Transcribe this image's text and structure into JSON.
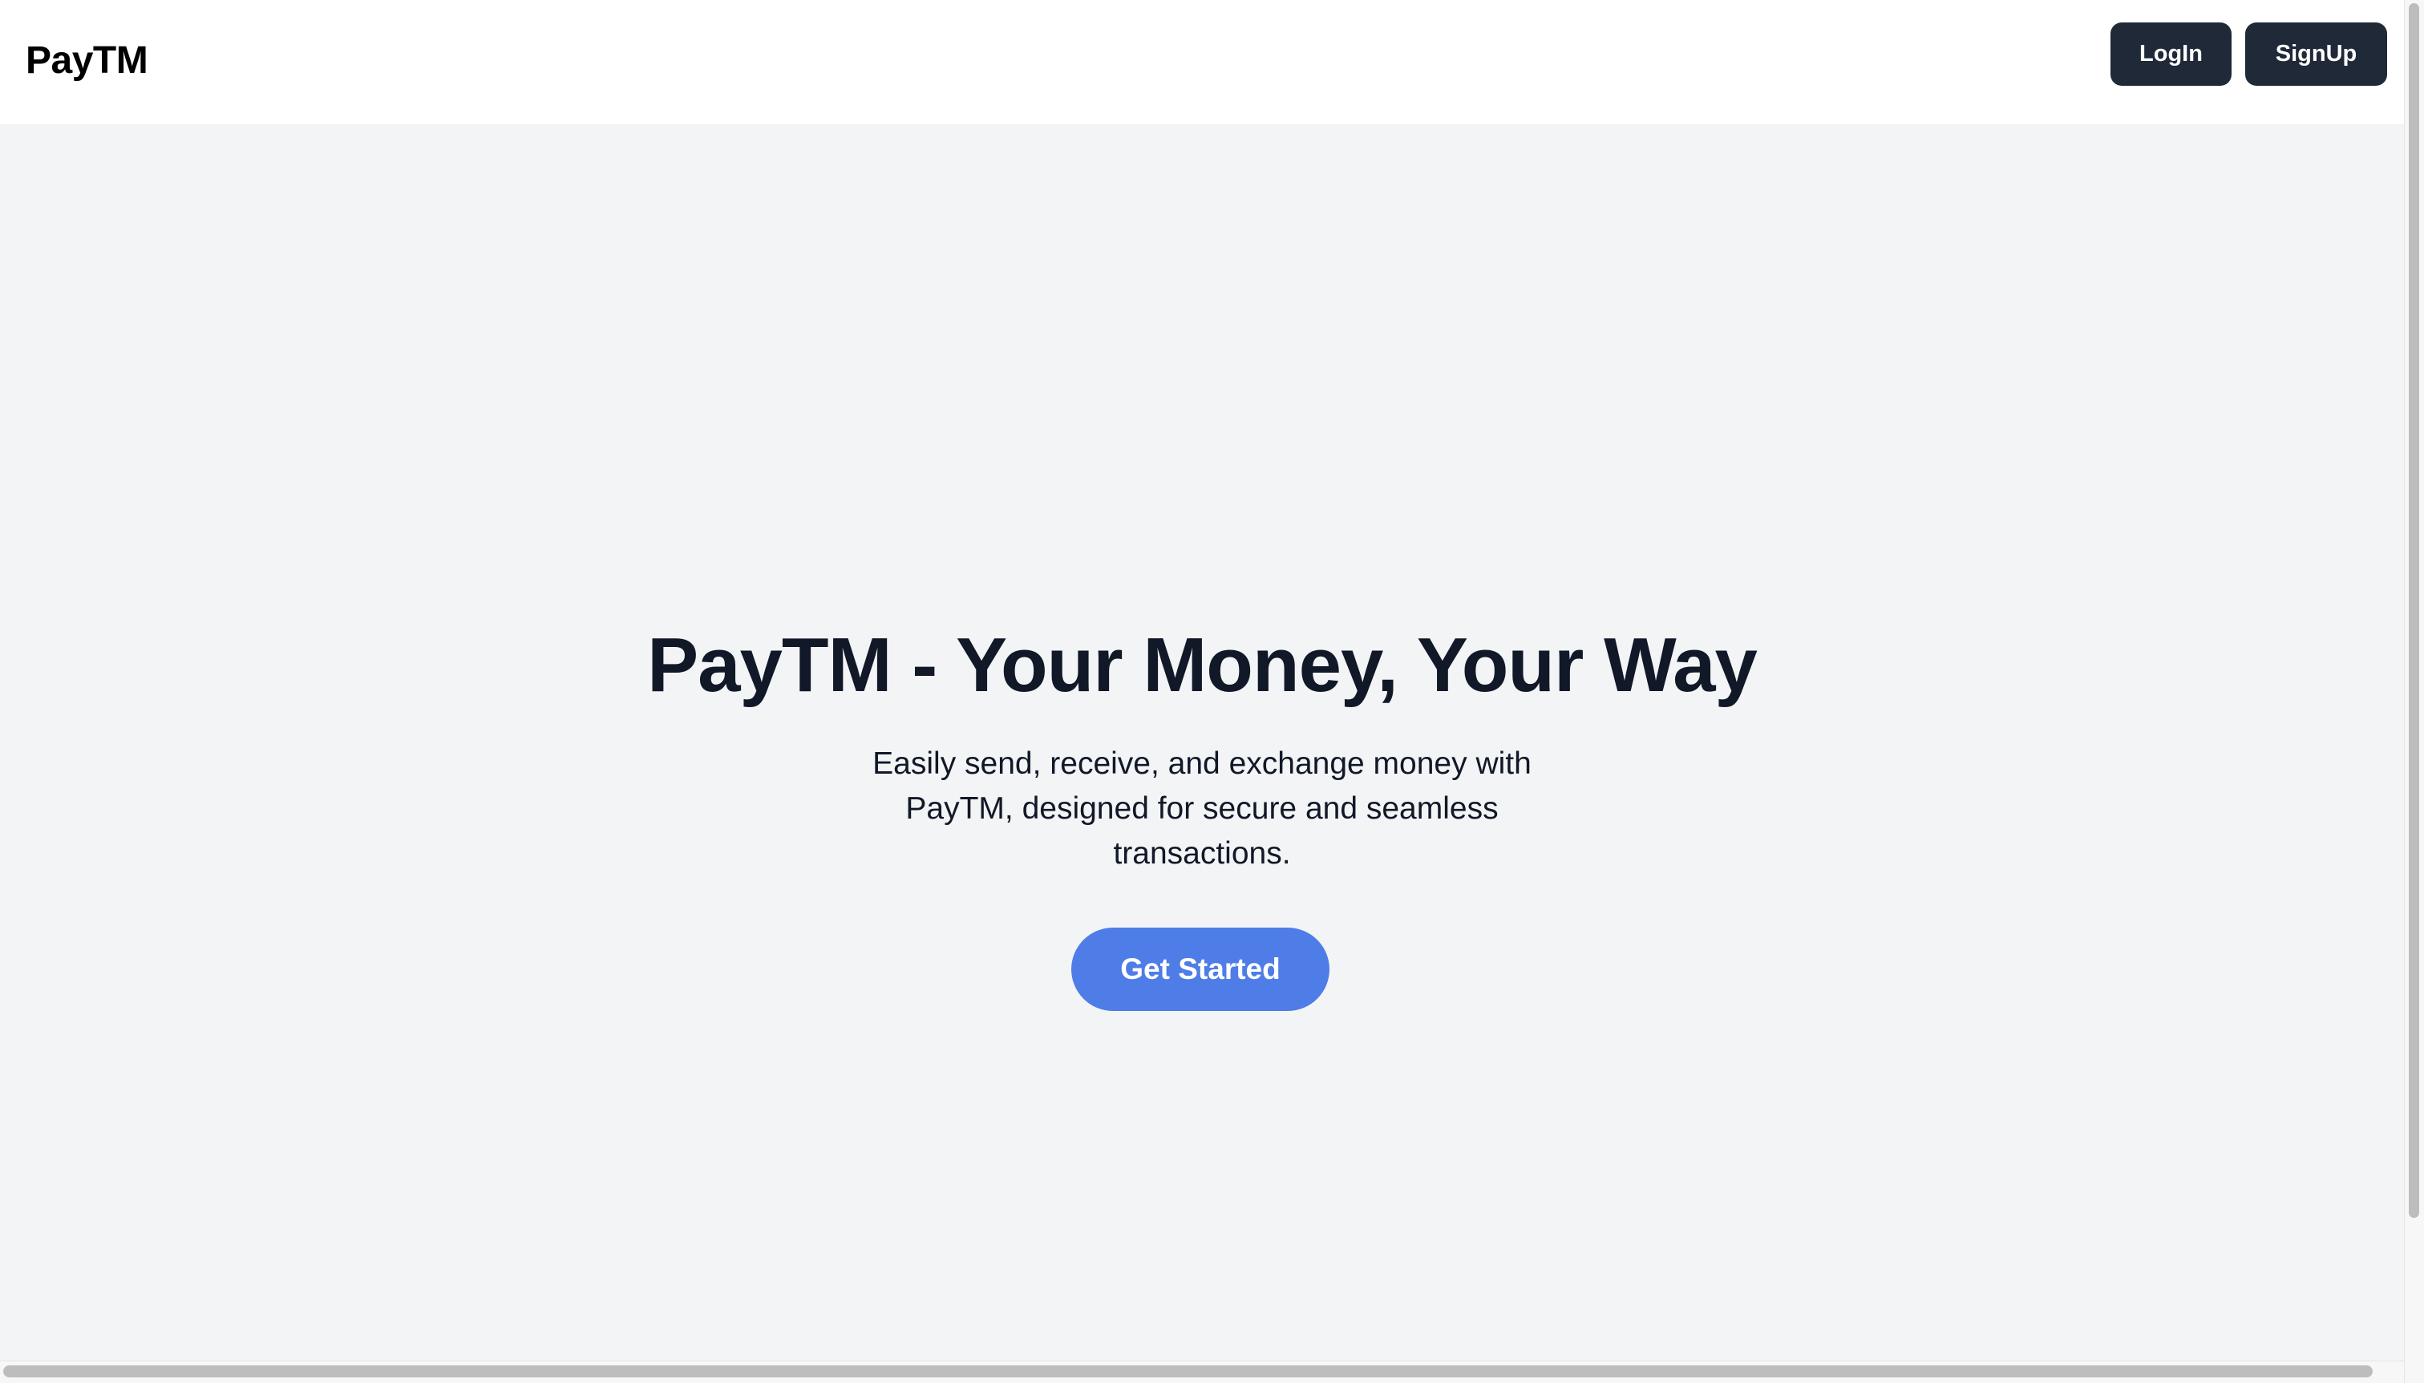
{
  "header": {
    "brand": "PayTM",
    "login_label": "LogIn",
    "signup_label": "SignUp"
  },
  "hero": {
    "title": "PayTM - Your Money, Your Way",
    "description": "Easily send, receive, and exchange money with PayTM, designed for secure and seamless transactions.",
    "cta_label": "Get Started"
  },
  "colors": {
    "page_background": "#f3f4f6",
    "navbar_background": "#ffffff",
    "nav_button": "#1f2937",
    "cta_button": "#4f7de7",
    "text_dark": "#111827"
  }
}
